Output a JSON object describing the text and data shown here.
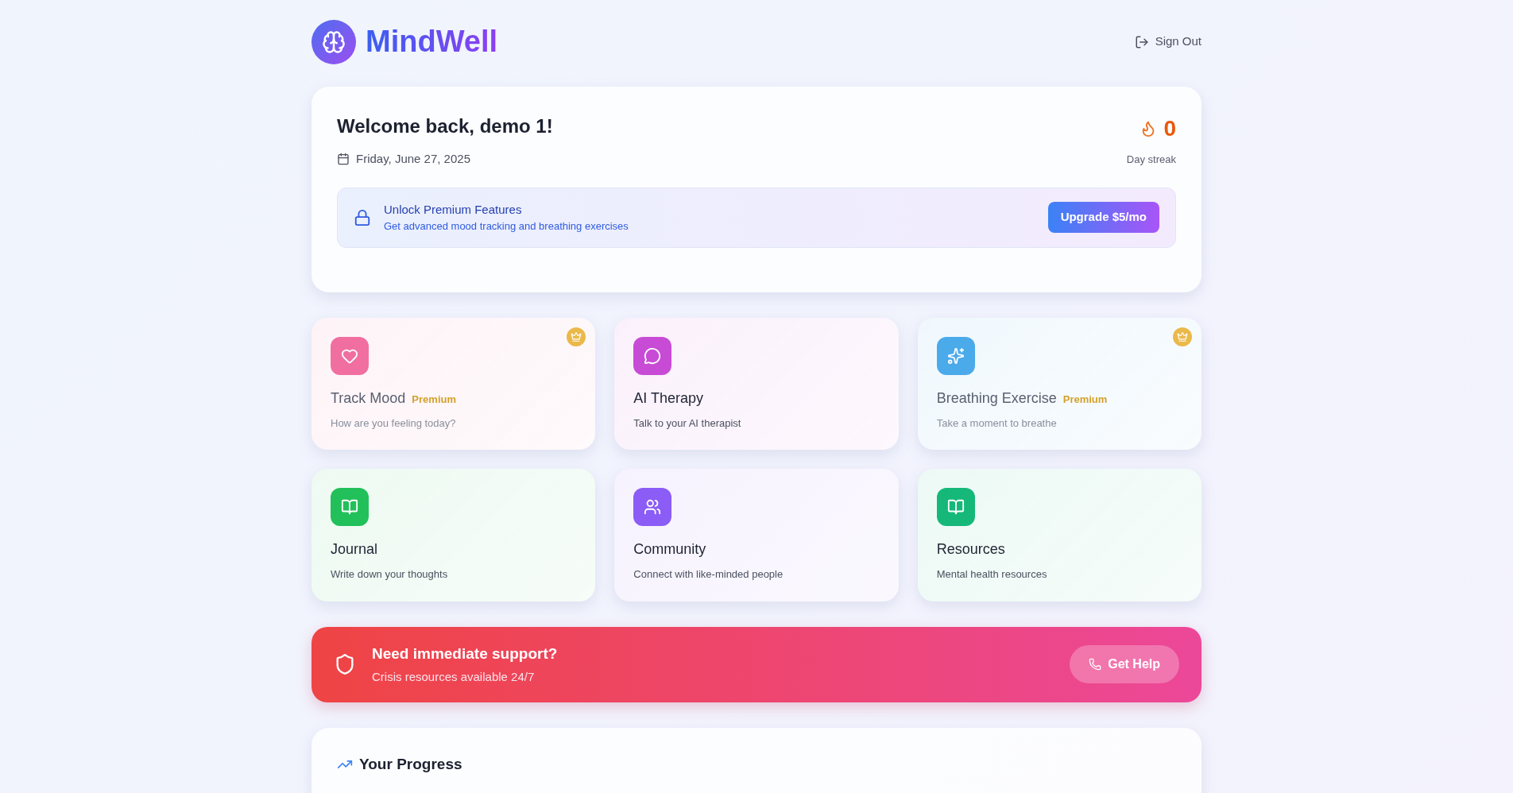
{
  "brand": "MindWell",
  "sign_out": "Sign Out",
  "welcome": {
    "title": "Welcome back, demo 1!",
    "date": "Friday, June 27, 2025",
    "streak": "0",
    "streak_label": "Day streak"
  },
  "premium_banner": {
    "title": "Unlock Premium Features",
    "subtitle": "Get advanced mood tracking and breathing exercises",
    "button": "Upgrade $5/mo"
  },
  "features": [
    {
      "kind": "heart",
      "title": "Track Mood",
      "badge": "Premium",
      "locked": true,
      "subtitle": "How are you feeling today?",
      "color": "#f06fa0"
    },
    {
      "kind": "chat",
      "title": "AI Therapy",
      "locked": false,
      "subtitle": "Talk to your AI therapist",
      "color": "#c84bd6"
    },
    {
      "kind": "sparkles",
      "title": "Breathing Exercise",
      "badge": "Premium",
      "locked": true,
      "subtitle": "Take a moment to breathe",
      "color": "#4aaaea"
    },
    {
      "kind": "book",
      "title": "Journal",
      "locked": false,
      "subtitle": "Write down your thoughts",
      "color": "#22c05a"
    },
    {
      "kind": "people",
      "title": "Community",
      "locked": false,
      "subtitle": "Connect with like-minded people",
      "color": "#8b5cf6"
    },
    {
      "kind": "book",
      "title": "Resources",
      "locked": false,
      "subtitle": "Mental health resources",
      "color": "#16b87a"
    }
  ],
  "crisis": {
    "title": "Need immediate support?",
    "subtitle": "Crisis resources available 24/7",
    "button": "Get Help"
  },
  "progress": {
    "title": "Your Progress"
  }
}
